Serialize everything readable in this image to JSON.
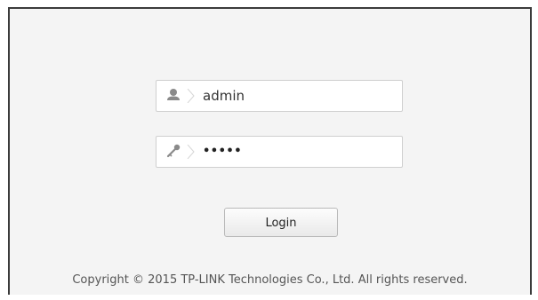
{
  "login": {
    "username": {
      "icon": "user-icon",
      "value": "admin"
    },
    "password": {
      "icon": "key-icon",
      "value": "•••••"
    },
    "button_label": "Login"
  },
  "footer": {
    "copyright": "Copyright © 2015 TP-LINK Technologies Co., Ltd. All rights reserved."
  }
}
